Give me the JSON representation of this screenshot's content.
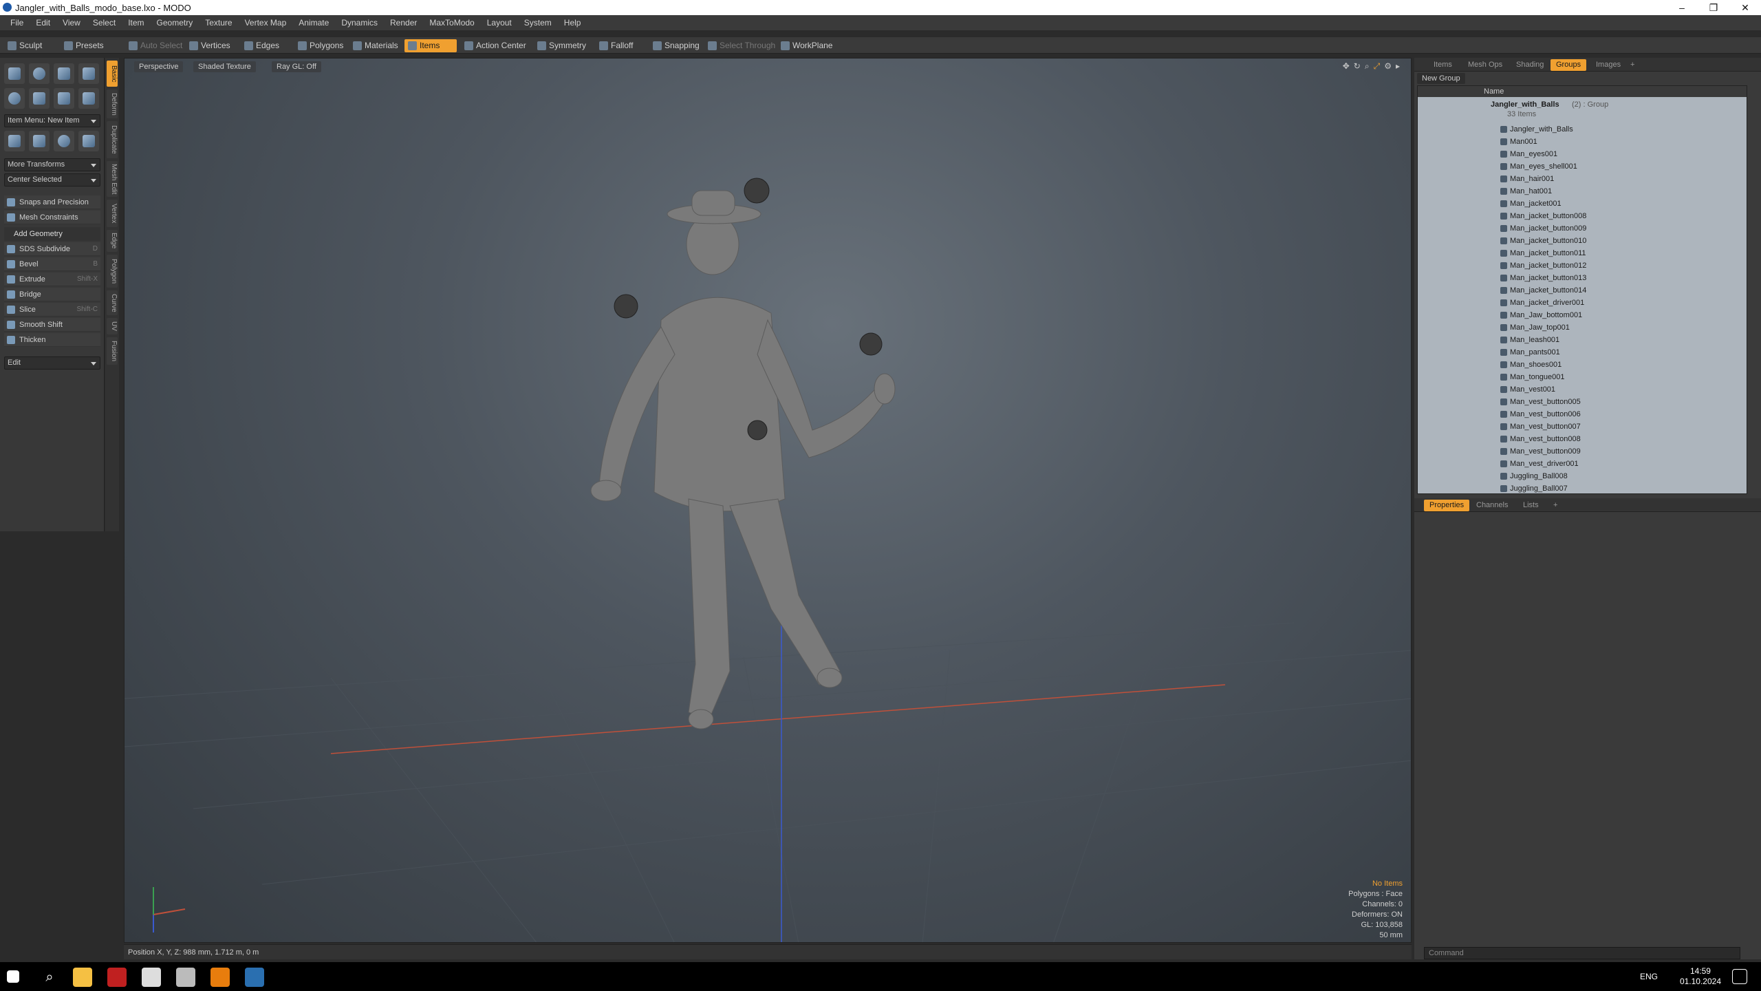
{
  "window": {
    "title": "Jangler_with_Balls_modo_base.lxo - MODO",
    "minimize": "–",
    "maximize": "❐",
    "close": "✕"
  },
  "menu": [
    "File",
    "Edit",
    "View",
    "Select",
    "Item",
    "Geometry",
    "Texture",
    "Vertex Map",
    "Animate",
    "Dynamics",
    "Render",
    "MaxToModo",
    "Layout",
    "System",
    "Help"
  ],
  "toolbar": {
    "sculpt": "Sculpt",
    "presets": "Presets",
    "auto_select": "Auto Select",
    "vertices": "Vertices",
    "edges": "Edges",
    "polygons": "Polygons",
    "materials": "Materials",
    "items": "Items",
    "action_center": "Action Center",
    "symmetry": "Symmetry",
    "falloff": "Falloff",
    "snapping": "Snapping",
    "select_through": "Select Through",
    "workplane": "WorkPlane"
  },
  "left": {
    "item_menu": "Item Menu: New Item",
    "more_transforms": "More Transforms",
    "center_selected": "Center Selected",
    "snaps": "Snaps and Precision",
    "mesh_constraints": "Mesh Constraints",
    "add_geometry": "Add Geometry",
    "tools": [
      {
        "label": "SDS Subdivide",
        "shortcut": "D"
      },
      {
        "label": "Bevel",
        "shortcut": "B"
      },
      {
        "label": "Extrude",
        "shortcut": "Shift-X"
      },
      {
        "label": "Bridge",
        "shortcut": ""
      },
      {
        "label": "Slice",
        "shortcut": "Shift-C"
      },
      {
        "label": "Smooth Shift",
        "shortcut": ""
      },
      {
        "label": "Thicken",
        "shortcut": ""
      }
    ],
    "edit": "Edit",
    "vtabs": [
      "Basic",
      "Deform",
      "Duplicate",
      "Mesh Edit",
      "Vertex",
      "Edge",
      "Polygon",
      "Curve",
      "UV",
      "Fusion"
    ]
  },
  "viewport": {
    "perspective": "Perspective",
    "shading": "Shaded Texture",
    "raygl": "Ray GL: Off",
    "info": [
      "No Items",
      "Polygons : Face",
      "Channels: 0",
      "Deformers: ON",
      "GL: 103,858",
      "50 mm"
    ],
    "position": "Position X, Y, Z:  988 mm, 1.712 m, 0 m"
  },
  "right": {
    "tabs": [
      "Items",
      "Mesh Ops",
      "Shading",
      "Groups",
      "Images",
      "+"
    ],
    "new_group": "New Group",
    "name_header": "Name",
    "group": {
      "name": "Jangler_with_Balls",
      "meta": "(2) : Group",
      "count": "33 Items"
    },
    "items": [
      "Jangler_with_Balls",
      "Man001",
      "Man_eyes001",
      "Man_eyes_shell001",
      "Man_hair001",
      "Man_hat001",
      "Man_jacket001",
      "Man_jacket_button008",
      "Man_jacket_button009",
      "Man_jacket_button010",
      "Man_jacket_button011",
      "Man_jacket_button012",
      "Man_jacket_button013",
      "Man_jacket_button014",
      "Man_jacket_driver001",
      "Man_Jaw_bottom001",
      "Man_Jaw_top001",
      "Man_leash001",
      "Man_pants001",
      "Man_shoes001",
      "Man_tongue001",
      "Man_vest001",
      "Man_vest_button005",
      "Man_vest_button006",
      "Man_vest_button007",
      "Man_vest_button008",
      "Man_vest_button009",
      "Man_vest_driver001",
      "Juggling_Ball008",
      "Juggling_Ball007"
    ],
    "bottom_tabs": [
      "Properties",
      "Channels",
      "Lists",
      "+"
    ],
    "command": "Command"
  },
  "taskbar": {
    "lang": "ENG",
    "time": "14:59",
    "date": "01.10.2024"
  },
  "colors": {
    "accent": "#f0a030",
    "grid_x": "#c0503a",
    "grid_y": "#3a5ad0"
  }
}
